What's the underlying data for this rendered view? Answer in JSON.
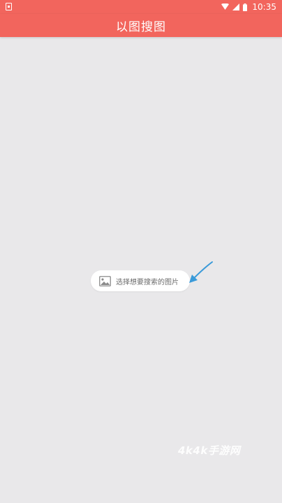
{
  "status_bar": {
    "time": "10:35",
    "icons": [
      "notification-icon",
      "wifi-icon",
      "signal-icon",
      "battery-icon"
    ]
  },
  "app_bar": {
    "title": "以图搜图"
  },
  "main": {
    "select_image_label": "选择想要搜索的图片",
    "select_image_icon": "image-icon"
  },
  "watermark": {
    "text": "4k4k手游网"
  },
  "colors": {
    "accent": "#f2655d",
    "background": "#e9e8ea",
    "arrow": "#3a9ad9"
  }
}
